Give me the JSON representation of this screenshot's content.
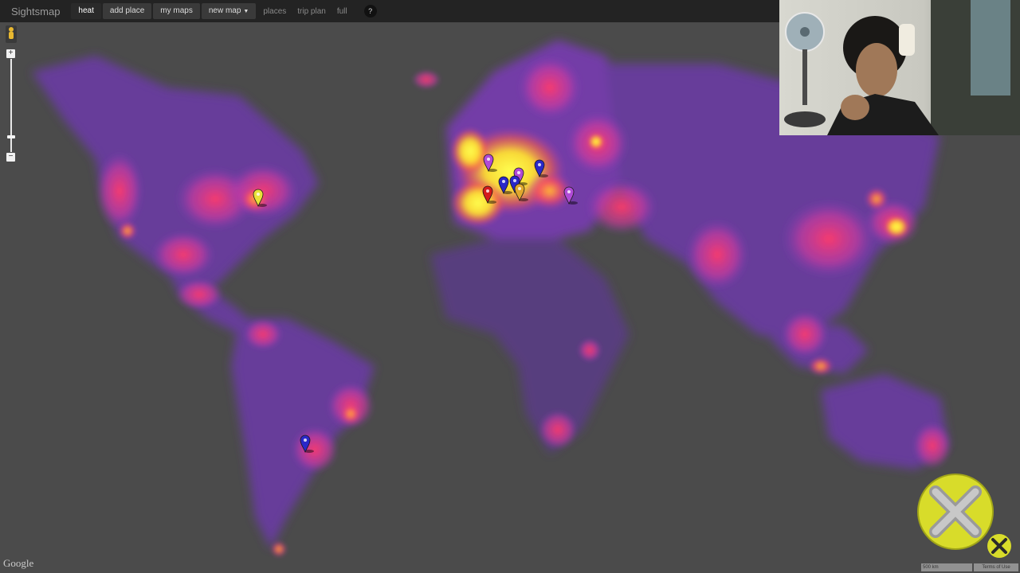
{
  "toolbar": {
    "brand": "Sightsmap",
    "heat_label": "heat",
    "add_place_label": "add place",
    "my_maps_label": "my maps",
    "new_map_label": "new map",
    "places_label": "places",
    "trip_plan_label": "trip plan",
    "full_label": "full",
    "help_label": "?"
  },
  "map": {
    "google_logo": "Google",
    "scale_label": "500 km",
    "terms_label": "Terms of Use",
    "zoom_in_label": "+",
    "zoom_out_label": "−",
    "markers": [
      {
        "name": "marker-usa-east",
        "color": "#e8e23a"
      },
      {
        "name": "marker-paris",
        "color": "#b04ad6"
      },
      {
        "name": "marker-central-europe-a",
        "color": "#b04ad6"
      },
      {
        "name": "marker-central-europe-b",
        "color": "#2a28c8"
      },
      {
        "name": "marker-switzerland",
        "color": "#2a28c8"
      },
      {
        "name": "marker-poland",
        "color": "#2a28c8"
      },
      {
        "name": "marker-italy-north",
        "color": "#e0a82e"
      },
      {
        "name": "marker-spain-north",
        "color": "#d41c1c"
      },
      {
        "name": "marker-balkans",
        "color": "#b04ad6"
      },
      {
        "name": "marker-argentina",
        "color": "#2a28c8"
      }
    ]
  },
  "overlay": {
    "close_icon": "close-icon",
    "close_small_icon": "close-icon"
  },
  "colors": {
    "map_bg": "#4b4b4b",
    "heat_low": "#7b3fc4",
    "heat_mid": "#ff3a78",
    "heat_high": "#ffee33",
    "toolbar_bg": "#232323"
  }
}
